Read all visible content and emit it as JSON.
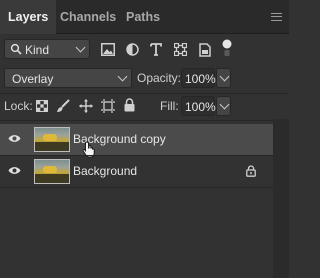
{
  "tabs": [
    {
      "label": "Layers",
      "active": true
    },
    {
      "label": "Channels",
      "active": false
    },
    {
      "label": "Paths",
      "active": false
    }
  ],
  "filter": {
    "kind_label": "Kind",
    "icons": [
      "image-filter-icon",
      "adjustment-filter-icon",
      "type-filter-icon",
      "shape-filter-icon",
      "smart-object-filter-icon",
      "filter-toggle-icon"
    ]
  },
  "blend": {
    "mode": "Overlay",
    "opacity_label": "Opacity:",
    "opacity_value": "100%"
  },
  "lock": {
    "label": "Lock:",
    "icons": [
      "lock-transparent-icon",
      "lock-image-icon",
      "lock-position-icon",
      "lock-artboard-icon",
      "lock-all-icon"
    ],
    "fill_label": "Fill:",
    "fill_value": "100%"
  },
  "layers": [
    {
      "name": "Background copy",
      "selected": true,
      "visible": true,
      "locked": false
    },
    {
      "name": "Background",
      "selected": false,
      "visible": true,
      "locked": true
    }
  ],
  "colors": {
    "panel_bg": "#323232",
    "selected_row": "#4b4b4b",
    "tab_bar": "#2a2a2a"
  }
}
